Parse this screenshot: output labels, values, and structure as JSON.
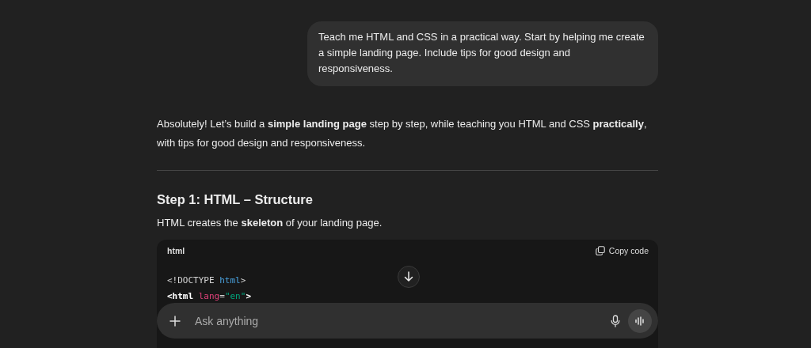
{
  "user_message": "Teach me HTML and CSS in a practical way. Start by helping me create a simple landing page. Include tips for good design and responsiveness.",
  "assistant": {
    "intro": "Absolutely! Let’s build a **simple landing page** step by step, while teaching you HTML and CSS **practically**, with tips for good design and responsiveness.",
    "heading": "Step 1: HTML – Structure",
    "lead": "HTML creates the **skeleton** of your landing page.",
    "code_block": {
      "language": "html",
      "copy_label": "Copy code",
      "lines": [
        [
          {
            "kind": "plain",
            "text": "<!DOCTYPE "
          },
          {
            "kind": "keyword",
            "text": "html"
          },
          {
            "kind": "plain",
            "text": ">"
          }
        ],
        [
          {
            "kind": "tag",
            "text": "<html "
          },
          {
            "kind": "attr",
            "text": "lang"
          },
          {
            "kind": "plain",
            "text": "="
          },
          {
            "kind": "string",
            "text": "\"en\""
          },
          {
            "kind": "tag",
            "text": ">"
          }
        ]
      ]
    }
  },
  "composer": {
    "placeholder": "Ask anything"
  }
}
